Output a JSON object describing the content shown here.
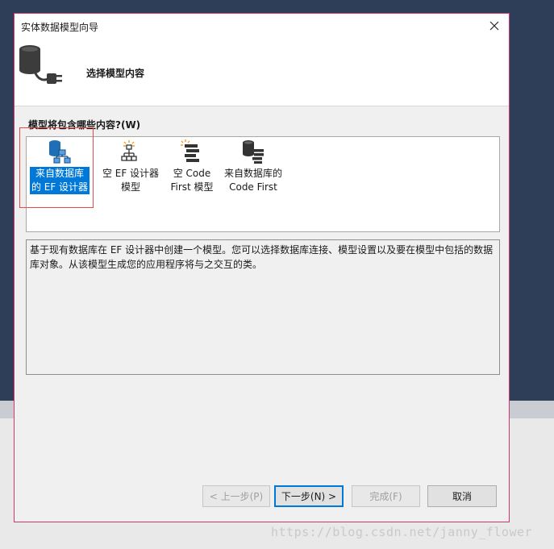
{
  "window": {
    "title": "实体数据模型向导",
    "close_icon": "close-icon"
  },
  "header": {
    "title": "选择模型内容",
    "icon": "database-plug-icon"
  },
  "prompt": "模型将包含哪些内容?(W)",
  "model_options": [
    {
      "label": "来自数据库\n的 EF 设计器",
      "icon": "database-diagram-icon",
      "selected": true
    },
    {
      "label": "空 EF 设计器\n模型",
      "icon": "empty-diagram-icon",
      "selected": false
    },
    {
      "label": "空 Code\nFirst 模型",
      "icon": "code-first-icon",
      "selected": false
    },
    {
      "label": "来自数据库的\nCode First",
      "icon": "database-code-icon",
      "selected": false
    }
  ],
  "description": "基于现有数据库在 EF 设计器中创建一个模型。您可以选择数据库连接、模型设置以及要在模型中包括的数据库对象。从该模型生成您的应用程序将与之交互的类。",
  "buttons": {
    "back": "< 上一步(P)",
    "next": "下一步(N) >",
    "finish": "完成(F)",
    "cancel": "取消"
  },
  "watermark": "https://blog.csdn.net/janny_flower",
  "colors": {
    "selection": "#0078d7",
    "dialog_border": "#d2356f",
    "highlight": "#e34a4a"
  }
}
